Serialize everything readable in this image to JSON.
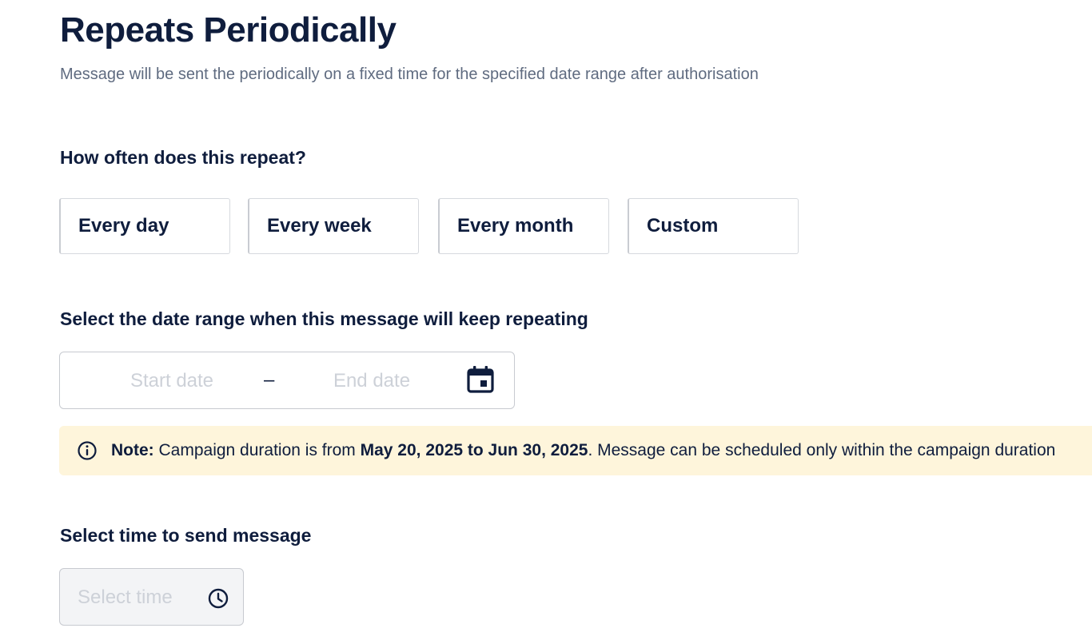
{
  "header": {
    "title": "Repeats Periodically",
    "subtitle": "Message will be sent the periodically on a fixed time for the specified date range after authorisation"
  },
  "frequency": {
    "question": "How often does this repeat?",
    "options": [
      {
        "label": "Every day"
      },
      {
        "label": "Every week"
      },
      {
        "label": "Every month"
      },
      {
        "label": "Custom"
      }
    ]
  },
  "date_range": {
    "label": "Select the date range when this message will keep repeating",
    "start_placeholder": "Start date",
    "start_value": "",
    "separator": "–",
    "end_placeholder": "End date",
    "end_value": "",
    "icon": "calendar-icon"
  },
  "note": {
    "icon": "info-icon",
    "prefix": "Note:",
    "text_before": " Campaign duration is from ",
    "date_range": "May 20, 2025 to Jun 30, 2025",
    "text_after": ". Message can be scheduled only within the campaign duration",
    "background": "#fef5db"
  },
  "time": {
    "label": "Select time to send message",
    "placeholder": "Select time",
    "value": "",
    "icon": "clock-icon"
  },
  "colors": {
    "text_primary": "#0f1d3d",
    "text_secondary": "#5f6b80",
    "placeholder": "#cdd1d8",
    "border": "#c7cad0"
  }
}
